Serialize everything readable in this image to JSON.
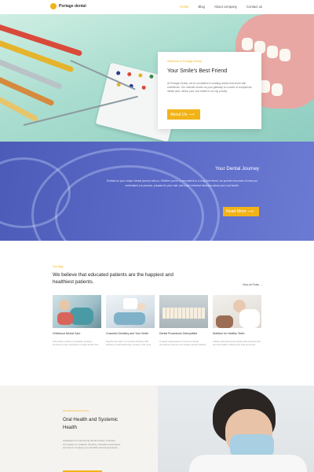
{
  "nav": {
    "logo_text": "Portage dental",
    "links": [
      "Home",
      "Blog",
      "About company",
      "Contact us"
    ],
    "active_index": 0
  },
  "hero": {
    "eyebrow": "Welcome to Portage Dental",
    "title": "Your Smile's Best Friend",
    "text": "At Portage Dental, we're committed to creating smiles that shine with confidence. Our website serves as your gateway to a world of exceptional dental care, where your oral health is our top priority.",
    "button_label": "About Us"
  },
  "journey": {
    "title": "Your Dental Journey",
    "text": "Embark on your unique dental journey with us. Whether you're a new patient or a long-time friend, we provide resources to help you understand our process, prepare for your visit, and make informed decisions about your oral health.",
    "button_label": "Read More"
  },
  "blog": {
    "eyebrow": "Our Blog",
    "title": "We believe that educated patients are the happiest and healthiest patients.",
    "view_all": "View all Posts",
    "cards": [
      {
        "title": "Childhood Dental Care",
        "text": "Informative content on pediatric dentistry, focusing on the importance of early dental care."
      },
      {
        "title": "Cosmetic Dentistry and Your Smile",
        "text": "Explore the realm of cosmetic dentistry with articles on teeth whitening, veneers, and more."
      },
      {
        "title": "Dental Procedures Demystified",
        "text": "In-depth explanations of common dental procedures such as root canals, dental implants."
      },
      {
        "title": "Nutrition for Healthy Teeth",
        "text": "Articles that discuss the relationship between diet and oral health, outlining the best and worst."
      }
    ]
  },
  "foot": {
    "eyebrow": "Managing Dental Anxiety",
    "title": "Oral Health and Systemic Health",
    "text": "Strategies for overcoming dental anxiety, including information on sedation dentistry, relaxation techniques, and tips for creating a comfortable dental experience."
  },
  "colors": {
    "accent": "#f2b318",
    "journey_bg": "#5563c1",
    "foot_bg": "#f5f3f0"
  },
  "icons": {
    "button_arrow": "arrow-right-icon",
    "logo": "tooth-logo-icon"
  }
}
